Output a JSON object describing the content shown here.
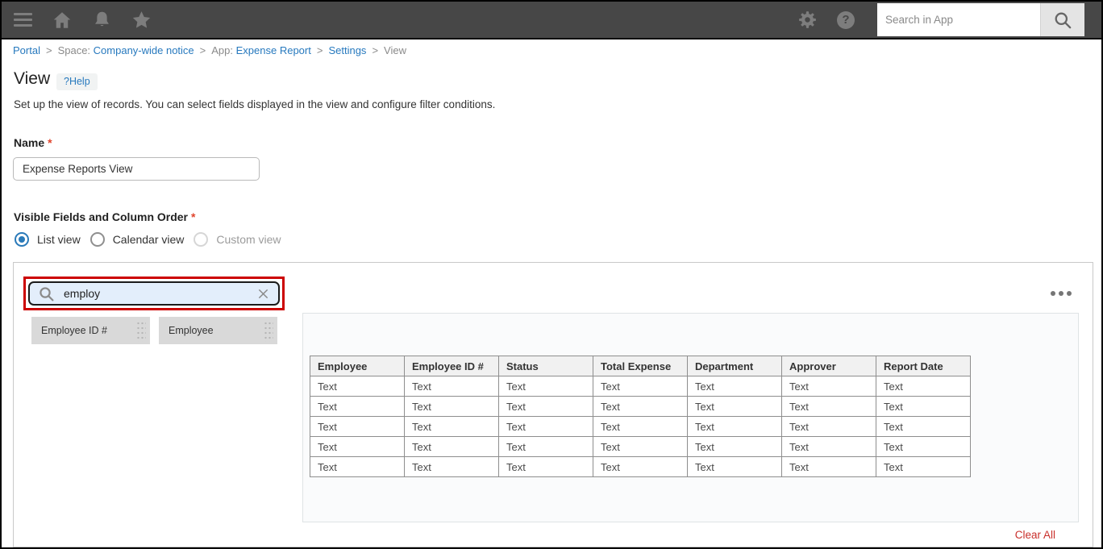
{
  "colors": {
    "topbar_bg": "#474747",
    "link_blue": "#2779be",
    "radio_blue": "#2a7ab9",
    "highlight_red": "#cc0000",
    "clear_all_red": "#c9302c"
  },
  "glyphs": {
    "help_question": "?"
  },
  "topbar": {
    "search": {
      "placeholder": "Search in App"
    }
  },
  "breadcrumb": {
    "separator": ">",
    "items": [
      {
        "prefix": "",
        "label": "Portal",
        "current": false
      },
      {
        "prefix": "Space: ",
        "label": "Company-wide notice",
        "current": false
      },
      {
        "prefix": "App: ",
        "label": "Expense Report",
        "current": false
      },
      {
        "prefix": "",
        "label": "Settings",
        "current": false
      },
      {
        "prefix": "",
        "label": "View",
        "current": true
      }
    ]
  },
  "page": {
    "title": "View",
    "help_label": "?Help",
    "description": "Set up the view of records. You can select fields displayed in the view and configure filter conditions."
  },
  "name_field": {
    "label": "Name",
    "required_mark": "*",
    "value": "Expense Reports View"
  },
  "view_type": {
    "label": "Visible Fields and Column Order",
    "required_mark": "*",
    "options": [
      {
        "label": "List view",
        "selected": true,
        "disabled": false
      },
      {
        "label": "Calendar view",
        "selected": false,
        "disabled": false
      },
      {
        "label": "Custom view",
        "selected": false,
        "disabled": true
      }
    ]
  },
  "field_picker": {
    "search_value": "employ",
    "chips": [
      "Employee ID #",
      "Employee"
    ],
    "clear_all_label": "Clear All"
  },
  "preview_table": {
    "columns": [
      "Employee",
      "Employee ID #",
      "Status",
      "Total Expense",
      "Department",
      "Approver",
      "Report Date"
    ],
    "rows": [
      [
        "Text",
        "Text",
        "Text",
        "Text",
        "Text",
        "Text",
        "Text"
      ],
      [
        "Text",
        "Text",
        "Text",
        "Text",
        "Text",
        "Text",
        "Text"
      ],
      [
        "Text",
        "Text",
        "Text",
        "Text",
        "Text",
        "Text",
        "Text"
      ],
      [
        "Text",
        "Text",
        "Text",
        "Text",
        "Text",
        "Text",
        "Text"
      ],
      [
        "Text",
        "Text",
        "Text",
        "Text",
        "Text",
        "Text",
        "Text"
      ]
    ]
  }
}
